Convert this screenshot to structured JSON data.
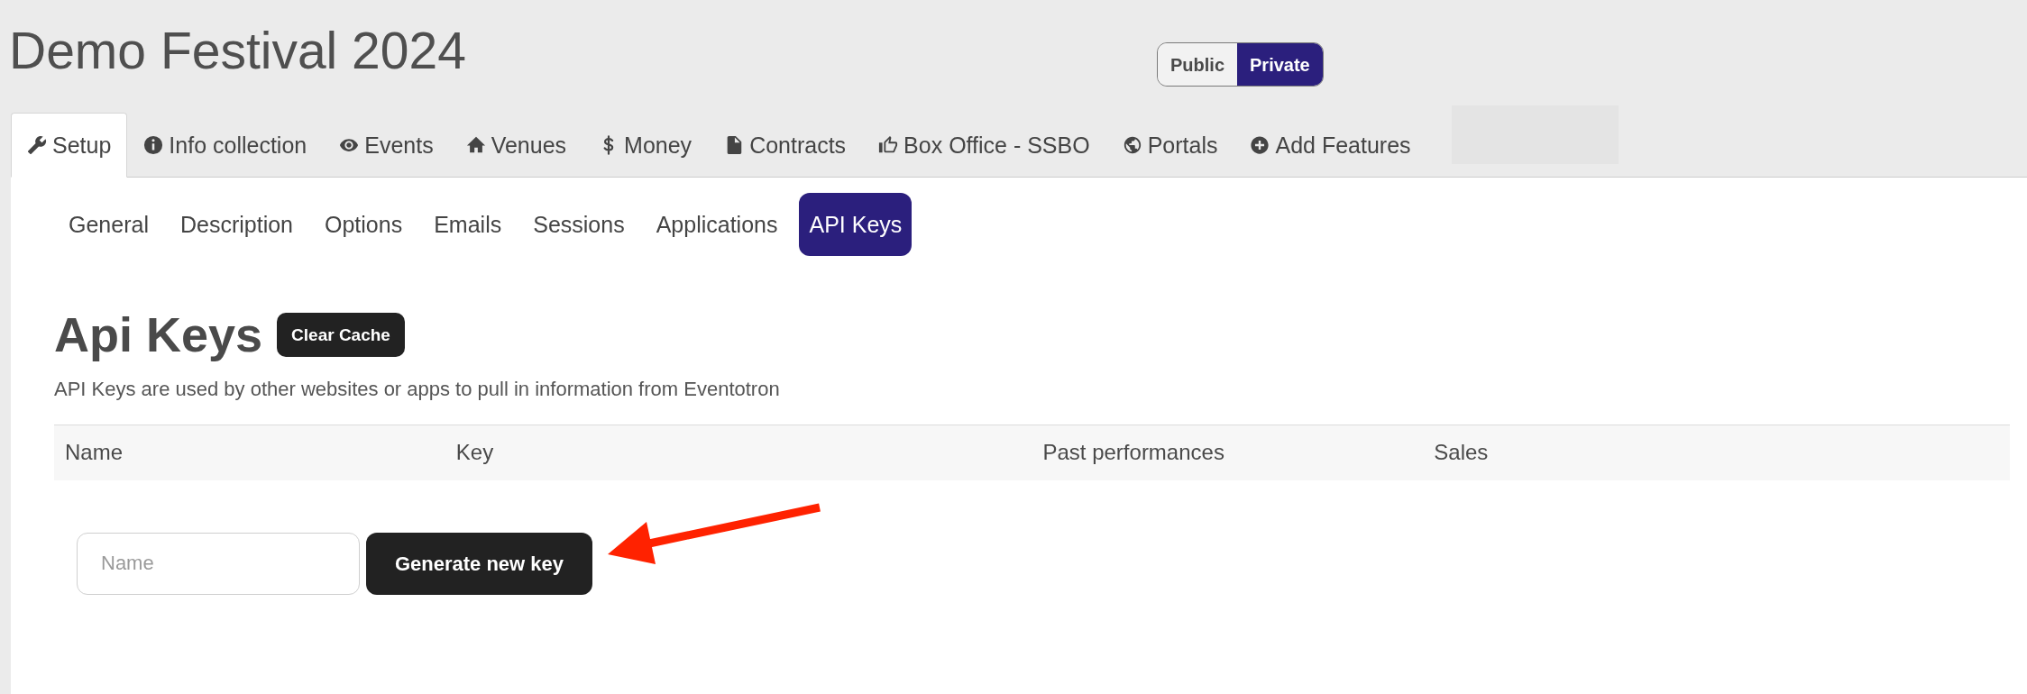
{
  "page_title": "Demo Festival 2024",
  "visibility_toggle": [
    {
      "label": "Public",
      "selected": false
    },
    {
      "label": "Private",
      "selected": true
    }
  ],
  "tabs": [
    {
      "label": "Setup",
      "selected": true
    },
    {
      "label": "Info collection",
      "selected": false
    },
    {
      "label": "Events",
      "selected": false
    },
    {
      "label": "Venues",
      "selected": false
    },
    {
      "label": "Money",
      "selected": false
    },
    {
      "label": "Contracts",
      "selected": false
    },
    {
      "label": "Box Office - SSBO",
      "selected": false
    },
    {
      "label": "Portals",
      "selected": false
    },
    {
      "label": "Add Features",
      "selected": false
    }
  ],
  "subtabs": [
    {
      "label": "General",
      "selected": false
    },
    {
      "label": "Description",
      "selected": false
    },
    {
      "label": "Options",
      "selected": false
    },
    {
      "label": "Emails",
      "selected": false
    },
    {
      "label": "Sessions",
      "selected": false
    },
    {
      "label": "Applications",
      "selected": false
    },
    {
      "label": "API Keys",
      "selected": true
    }
  ],
  "section": {
    "heading": "Api Keys",
    "clear_button": "Clear Cache",
    "description": "API Keys are used by other websites or apps to pull in information from Eventotron"
  },
  "table": {
    "columns": [
      "Name",
      "Key",
      "Past performances",
      "Sales"
    ]
  },
  "new_key_form": {
    "name_field": {
      "placeholder": "Name"
    },
    "submit_button": "Generate new key"
  }
}
